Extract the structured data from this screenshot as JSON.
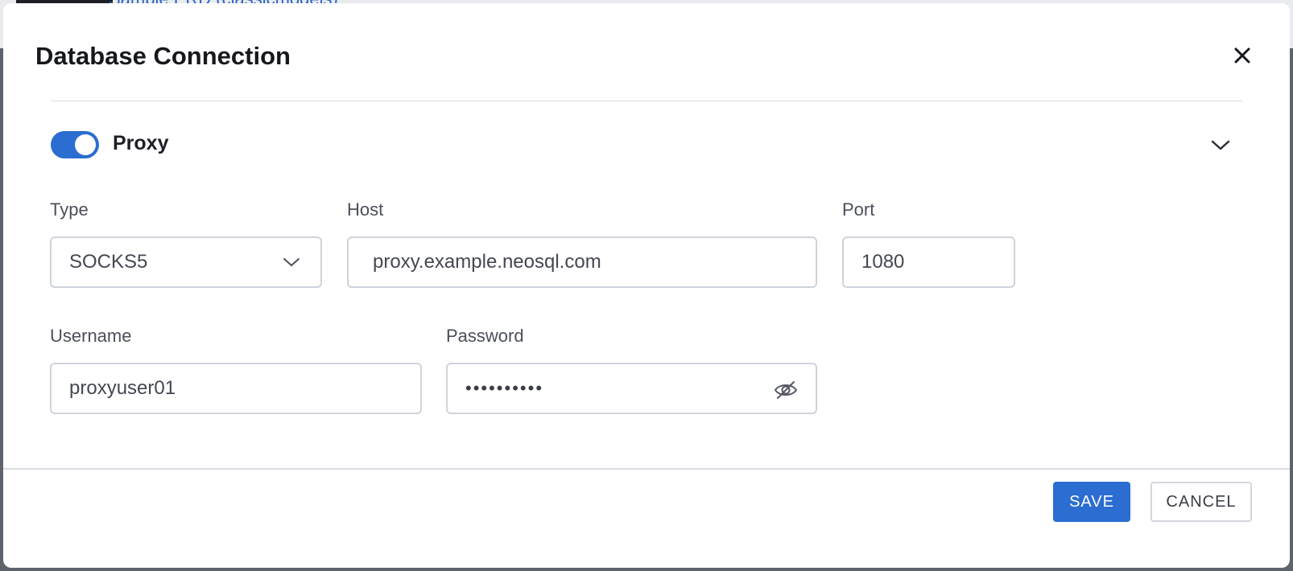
{
  "background": {
    "partial_title": "Sample ERD (classicmodels)"
  },
  "dialog": {
    "title": "Database Connection",
    "close_icon": "close-icon"
  },
  "proxy": {
    "enabled": true,
    "label": "Proxy",
    "collapse_icon": "chevron-down-icon"
  },
  "fields": {
    "type": {
      "label": "Type",
      "value": "SOCKS5"
    },
    "host": {
      "label": "Host",
      "value": "proxy.example.neosql.com"
    },
    "port": {
      "label": "Port",
      "value": "1080"
    },
    "username": {
      "label": "Username",
      "value": "proxyuser01"
    },
    "password": {
      "label": "Password",
      "value": "••••••••••",
      "visibility_icon": "eye-off-icon"
    }
  },
  "actions": {
    "save_label": "SAVE",
    "cancel_label": "CANCEL"
  },
  "colors": {
    "accent": "#2b6dd1",
    "border": "#cfd3db",
    "text": "#16181d"
  }
}
